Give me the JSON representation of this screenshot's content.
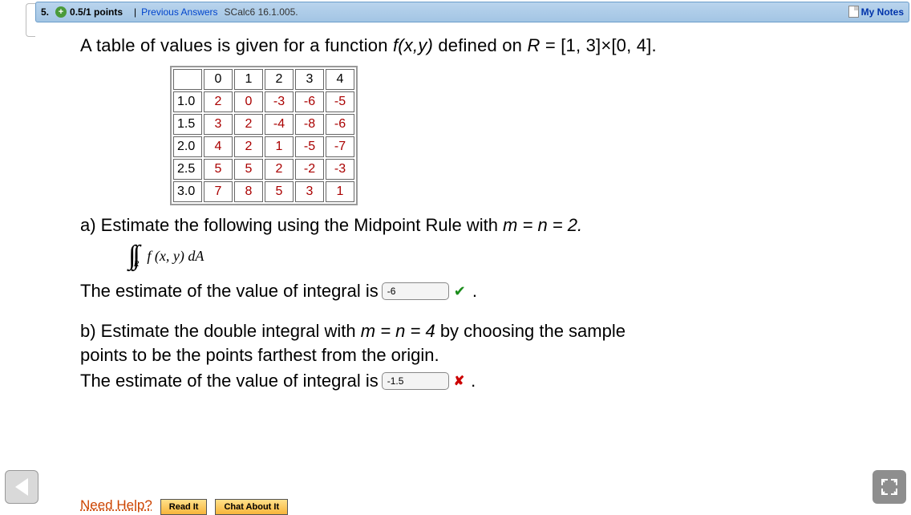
{
  "header": {
    "question_number": "5.",
    "points": "0.5/1 points",
    "separator": "|",
    "prev_answers": "Previous Answers",
    "source": "SCalc6 16.1.005.",
    "my_notes": "My Notes"
  },
  "prompt": {
    "pre": "A table of values is given for a function ",
    "func": "f(x,y)",
    "mid": " defined on ",
    "R": "R",
    "eq": " = [1, 3]×[0, 4]."
  },
  "table": {
    "col_headers": [
      "",
      "0",
      "1",
      "2",
      "3",
      "4"
    ],
    "rows": [
      {
        "h": "1.0",
        "v": [
          "2",
          "0",
          "-3",
          "-6",
          "-5"
        ]
      },
      {
        "h": "1.5",
        "v": [
          "3",
          "2",
          "-4",
          "-8",
          "-6"
        ]
      },
      {
        "h": "2.0",
        "v": [
          "4",
          "2",
          "1",
          "-5",
          "-7"
        ]
      },
      {
        "h": "2.5",
        "v": [
          "5",
          "5",
          "2",
          "-2",
          "-3"
        ]
      },
      {
        "h": "3.0",
        "v": [
          "7",
          "8",
          "5",
          "3",
          "1"
        ]
      }
    ]
  },
  "partA": {
    "text_pre": "a) Estimate the following using the Midpoint Rule with ",
    "mn": "m = n = 2.",
    "integral_text": "f (x, y) dA",
    "integral_sub": "R",
    "answer_pre": "The estimate of the value of integral is ",
    "answer_value": "-6",
    "period": "."
  },
  "partB": {
    "line1_pre": "b) Estimate the double integral with ",
    "mn": "m = n = 4",
    "line1_post": " by choosing the sample",
    "line2": "points to be the points farthest from the origin.",
    "answer_pre": "The estimate of the value of integral is ",
    "answer_value": "-1.5",
    "period": "."
  },
  "help": {
    "label": "Need Help?",
    "read": "Read It",
    "chat": "Chat About It"
  }
}
